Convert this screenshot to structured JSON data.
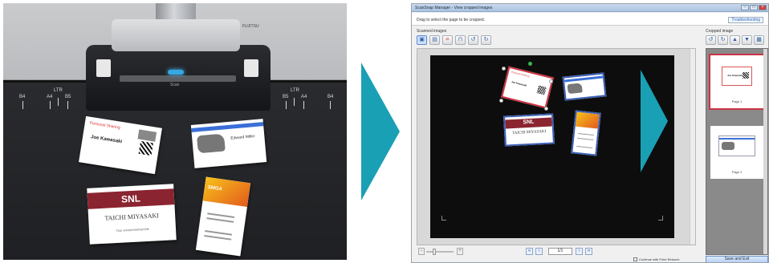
{
  "photo": {
    "scanner_brand": "FUJITSU",
    "scanner_label": "Scan",
    "marks_left": [
      "B4",
      "A4",
      "LTR",
      "B5"
    ],
    "marks_right": [
      "B5",
      "LTR",
      "A4",
      "B4"
    ],
    "cards": {
      "red_header": "Personal Sharing",
      "red_name": "Joe Kawasaki",
      "blue_name": "Edward Miller",
      "snl_logo": "SNL",
      "snl_name": "TAICHI MIYASAKI",
      "snl_sub": "Your environmental link",
      "orange_logo": "SMGA"
    }
  },
  "window": {
    "title": "ScanSnap Manager - View cropped images",
    "instruction": "Drag to select the page to be cropped.",
    "troubleshooting": "Troubleshooting",
    "scanned_images_label": "Scanned images",
    "cropped_image_label": "Cropped image",
    "page_indicator": "1/1",
    "thumbs": [
      {
        "label": "Page 1"
      },
      {
        "label": "Page 2"
      }
    ],
    "continue_label": "Continue with Point Retouch",
    "save_label": "Save and Exit"
  },
  "icons": {
    "left_toolbar": [
      "fit-page-icon",
      "crop-icon",
      "auto-crop-icon",
      "crop-manual-icon",
      "rotate-left-icon",
      "rotate-right-icon"
    ],
    "right_toolbar": [
      "rotate-left-icon",
      "rotate-right-icon",
      "move-up-icon",
      "move-down-icon",
      "delete-icon",
      "settings-icon"
    ]
  },
  "colors": {
    "accent_arrow": "#1aa0b5",
    "selection_red": "#cc3344",
    "card_border_blue": "#3c5fb3"
  }
}
